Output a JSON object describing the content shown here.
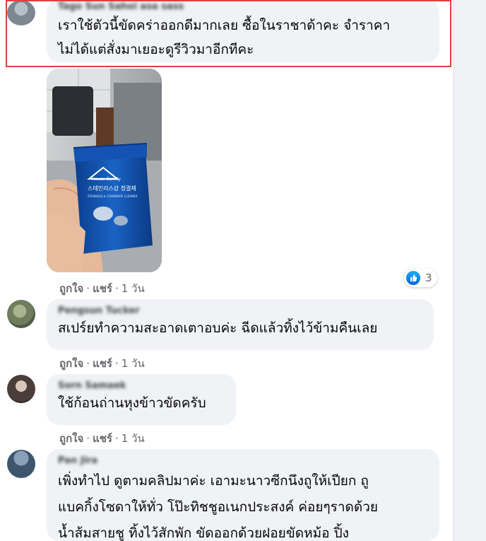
{
  "comments": [
    {
      "author": "Tago Sun Sahoi asa sass",
      "lines": [
        "เราใช้ตัวนี้ขัดคร่าออกดีมากเลย ซื้อในราชาด้าคะ จำราคา",
        "ไม่ได้แต่สั่งมาเยอะดูรีวิวมาอีกทีคะ"
      ],
      "reactions": {
        "count": "3",
        "icon": "like-icon"
      }
    },
    {
      "author": "Pengsun Tucker",
      "lines": [
        "สเปร์ยทำความสะอาดเตาอบค่ะ ฉีดแล้วทิ้งไว้ข้ามคืนเลย"
      ],
      "actions": {
        "like": "ถูกใจ",
        "reply": "แชร์",
        "time": "1 วัน"
      }
    },
    {
      "author": "Sorn Samaek",
      "lines": [
        "ใช้ก้อนถ่านหุงข้าวขัดครับ"
      ],
      "actions": {
        "like": "ถูกใจ",
        "reply": "แชร์",
        "time": "1 วัน"
      }
    },
    {
      "author": "Pan Jira",
      "lines": [
        "เพิ่งทำไป ดูตามคลิปมาค่ะ เอามะนาวซีกนึงถูให้เปียก ถู",
        "แบคกิ้งโซดาให้ทั่ว โป๊ะทิชชูอเนกประสงค์ ค่อยๆราดด้วย",
        "น้ำส้มสายชู ทิ้งไว้สักพัก ขัดออกด้วยฝอยขัดหม้อ ปิ้ง"
      ]
    }
  ],
  "first_actions": {
    "like": "ถูกใจ",
    "reply": "แชร์",
    "time": "1 วัน"
  },
  "photo": {
    "brand": "House Barrity",
    "korean": "스테인리스강 청결제",
    "product": "STAINLESS & COOKWARE CLEANER"
  },
  "separator": "·",
  "colors": {
    "highlight": "#e0413f",
    "bubble": "#f0f2f5",
    "like_blue": "#1877f2",
    "meta_gray": "#65676b"
  }
}
